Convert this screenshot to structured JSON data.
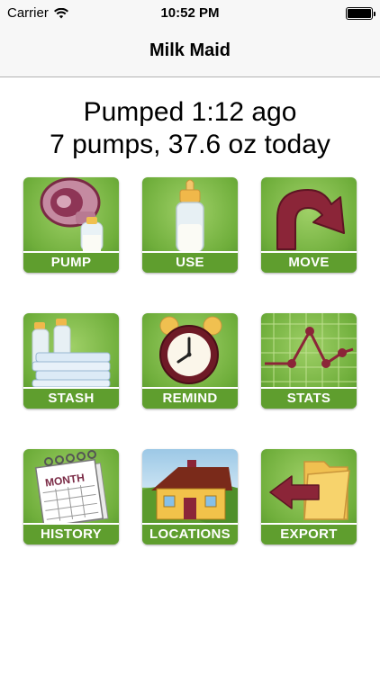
{
  "status_bar": {
    "carrier": "Carrier",
    "time": "10:52 PM",
    "battery_level": 1.0
  },
  "nav": {
    "title": "Milk Maid"
  },
  "summary": {
    "line1": "Pumped 1:12 ago",
    "line2": "7 pumps, 37.6 oz today"
  },
  "tiles": [
    {
      "label": "PUMP",
      "icon": "breast-pump-icon"
    },
    {
      "label": "USE",
      "icon": "bottle-icon"
    },
    {
      "label": "MOVE",
      "icon": "curved-arrow-icon"
    },
    {
      "label": "STASH",
      "icon": "bottles-and-bags-icon"
    },
    {
      "label": "REMIND",
      "icon": "alarm-clock-icon"
    },
    {
      "label": "STATS",
      "icon": "line-graph-icon"
    },
    {
      "label": "HISTORY",
      "icon": "calendar-icon"
    },
    {
      "label": "LOCATIONS",
      "icon": "house-icon"
    },
    {
      "label": "EXPORT",
      "icon": "folder-arrow-icon"
    }
  ],
  "colors": {
    "tile_green": "#6fae3b",
    "tile_label_green": "#5f9e2e",
    "accent_maroon": "#8b2538"
  }
}
